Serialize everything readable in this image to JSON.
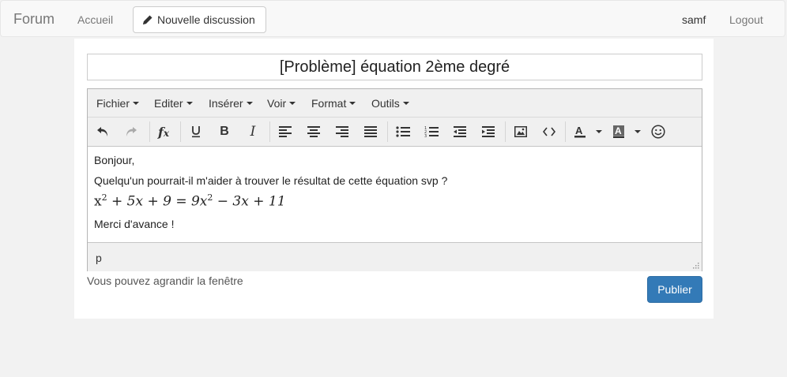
{
  "navbar": {
    "brand": "Forum",
    "home_link": "Accueil",
    "new_discussion_button": "Nouvelle discussion",
    "username": "samf",
    "logout_link": "Logout"
  },
  "form": {
    "title_value": "[Problème] équation 2ème degré",
    "hint": "Vous pouvez agrandir la fenêtre",
    "publish_button": "Publier"
  },
  "editor": {
    "menus": [
      "Fichier",
      "Editer",
      "Insérer",
      "Voir",
      "Format",
      "Outils"
    ],
    "toolbar_icons": [
      "undo-icon",
      "redo-icon",
      "formula-icon",
      "underline-icon",
      "bold-icon",
      "italic-icon",
      "align-left-icon",
      "align-center-icon",
      "align-right-icon",
      "align-justify-icon",
      "bullet-list-icon",
      "numbered-list-icon",
      "outdent-icon",
      "indent-icon",
      "image-icon",
      "code-icon",
      "text-color-icon",
      "background-color-icon",
      "emoticon-icon"
    ],
    "content": {
      "line1": "Bonjour,",
      "line2": "Quelqu'un pourrait-il m'aider à trouver le résultat de cette équation svp ?",
      "math": {
        "lhs_a": "x",
        "exp1": "2",
        "lhs_b": " + 5x + 9 = 9x",
        "exp2": "2",
        "rhs_c": " − 3x + 11"
      },
      "line4": "Merci d'avance !"
    },
    "status_path": "p"
  },
  "colors": {
    "publish": "#337ab7",
    "navbar_bg": "#f8f8f8",
    "page_bg": "#f2f2f2"
  }
}
